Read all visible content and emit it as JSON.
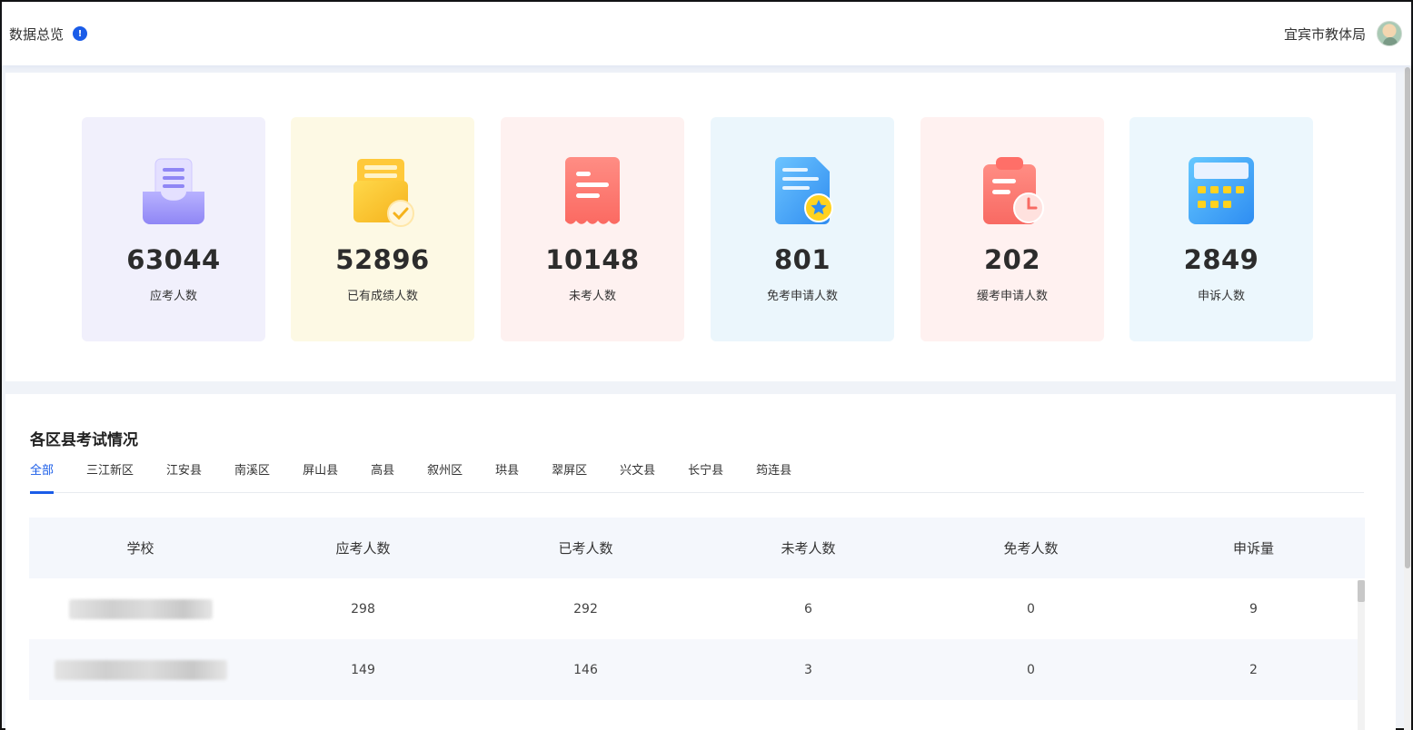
{
  "header": {
    "title": "数据总览",
    "info_glyph": "!",
    "org_name": "宜宾市教体局"
  },
  "stats": [
    {
      "value": "63044",
      "label": "应考人数",
      "bg": "#f1f0fc",
      "icon": "inbox-list-icon"
    },
    {
      "value": "52896",
      "label": "已有成绩人数",
      "bg": "#fdf9e4",
      "icon": "scored-folder-icon"
    },
    {
      "value": "10148",
      "label": "未考人数",
      "bg": "#fef1f0",
      "icon": "receipt-icon"
    },
    {
      "value": "801",
      "label": "免考申请人数",
      "bg": "#ebf6fc",
      "icon": "document-star-icon"
    },
    {
      "value": "202",
      "label": "缓考申请人数",
      "bg": "#fff1f0",
      "icon": "clipboard-clock-icon"
    },
    {
      "value": "2849",
      "label": "申诉人数",
      "bg": "#ecf7fd",
      "icon": "calculator-icon"
    }
  ],
  "district": {
    "title": "各区县考试情况",
    "tabs": [
      "全部",
      "三江新区",
      "江安县",
      "南溪区",
      "屏山县",
      "高县",
      "叙州区",
      "珙县",
      "翠屏区",
      "兴文县",
      "长宁县",
      "筠连县"
    ],
    "active_tab": 0,
    "columns": [
      "学校",
      "应考人数",
      "已考人数",
      "未考人数",
      "免考人数",
      "申诉量"
    ],
    "rows": [
      {
        "school": "",
        "expected": "298",
        "taken": "292",
        "absent": "6",
        "exempt": "0",
        "appeals": "9"
      },
      {
        "school": "",
        "expected": "149",
        "taken": "146",
        "absent": "3",
        "exempt": "0",
        "appeals": "2"
      }
    ]
  },
  "colors": {
    "accent": "#1a5ce8"
  }
}
